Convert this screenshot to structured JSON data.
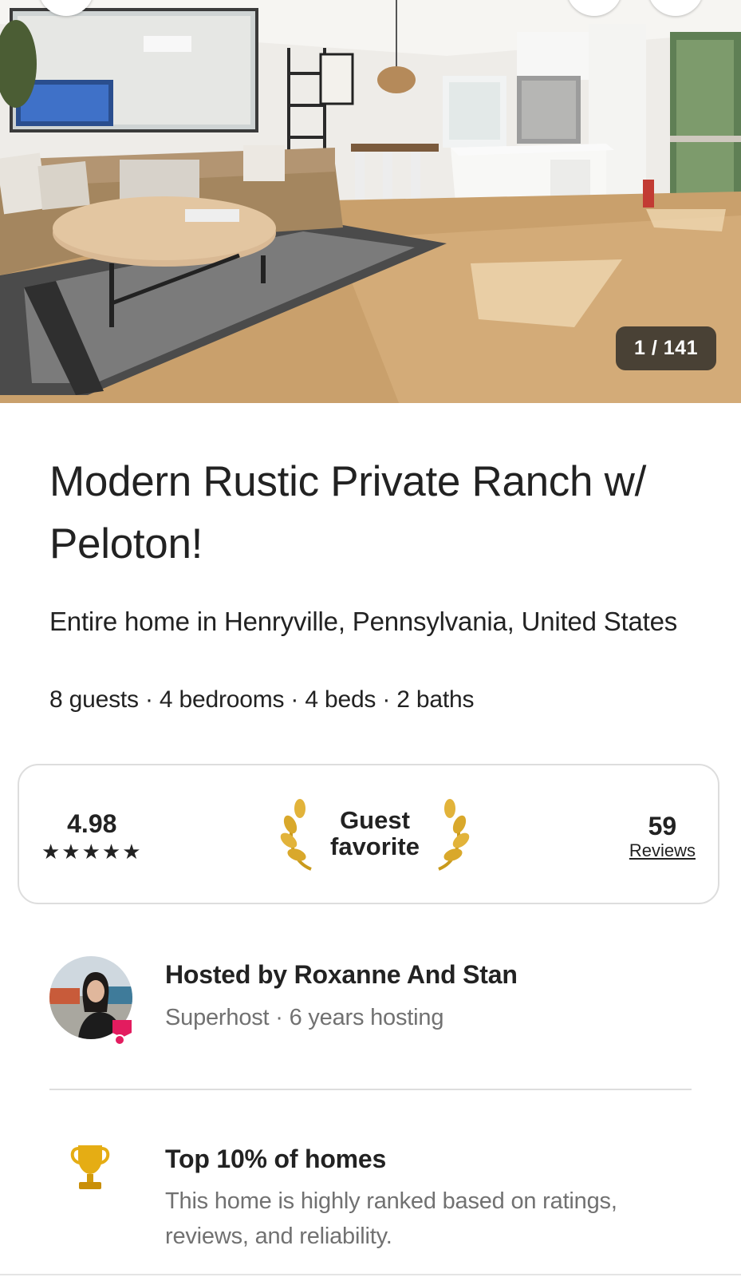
{
  "gallery": {
    "counter": "1 / 141",
    "buttons": {
      "back_icon": "back-arrow-icon",
      "share_icon": "share-icon",
      "save_icon": "heart-icon"
    }
  },
  "listing": {
    "title": "Modern Rustic Private Ranch w/ Peloton!",
    "subtitle": "Entire home in Henryville, Pennsylvania, United States",
    "details": "8 guests · 4 bedrooms · 4 beds · 2 baths"
  },
  "rating": {
    "value": "4.98",
    "stars": "★★★★★",
    "badge_line1": "Guest",
    "badge_line2": "favorite",
    "reviews_count": "59",
    "reviews_label": "Reviews"
  },
  "host": {
    "title": "Hosted by Roxanne And Stan",
    "subtitle": "Superhost · 6 years hosting"
  },
  "highlight": {
    "title": "Top 10% of homes",
    "body": "This home is highly ranked based on ratings, reviews, and reliability."
  },
  "colors": {
    "text": "#222222",
    "muted": "#717171",
    "border": "#dddddd",
    "brand": "#e31c5f",
    "gold": "#d4a21a"
  }
}
